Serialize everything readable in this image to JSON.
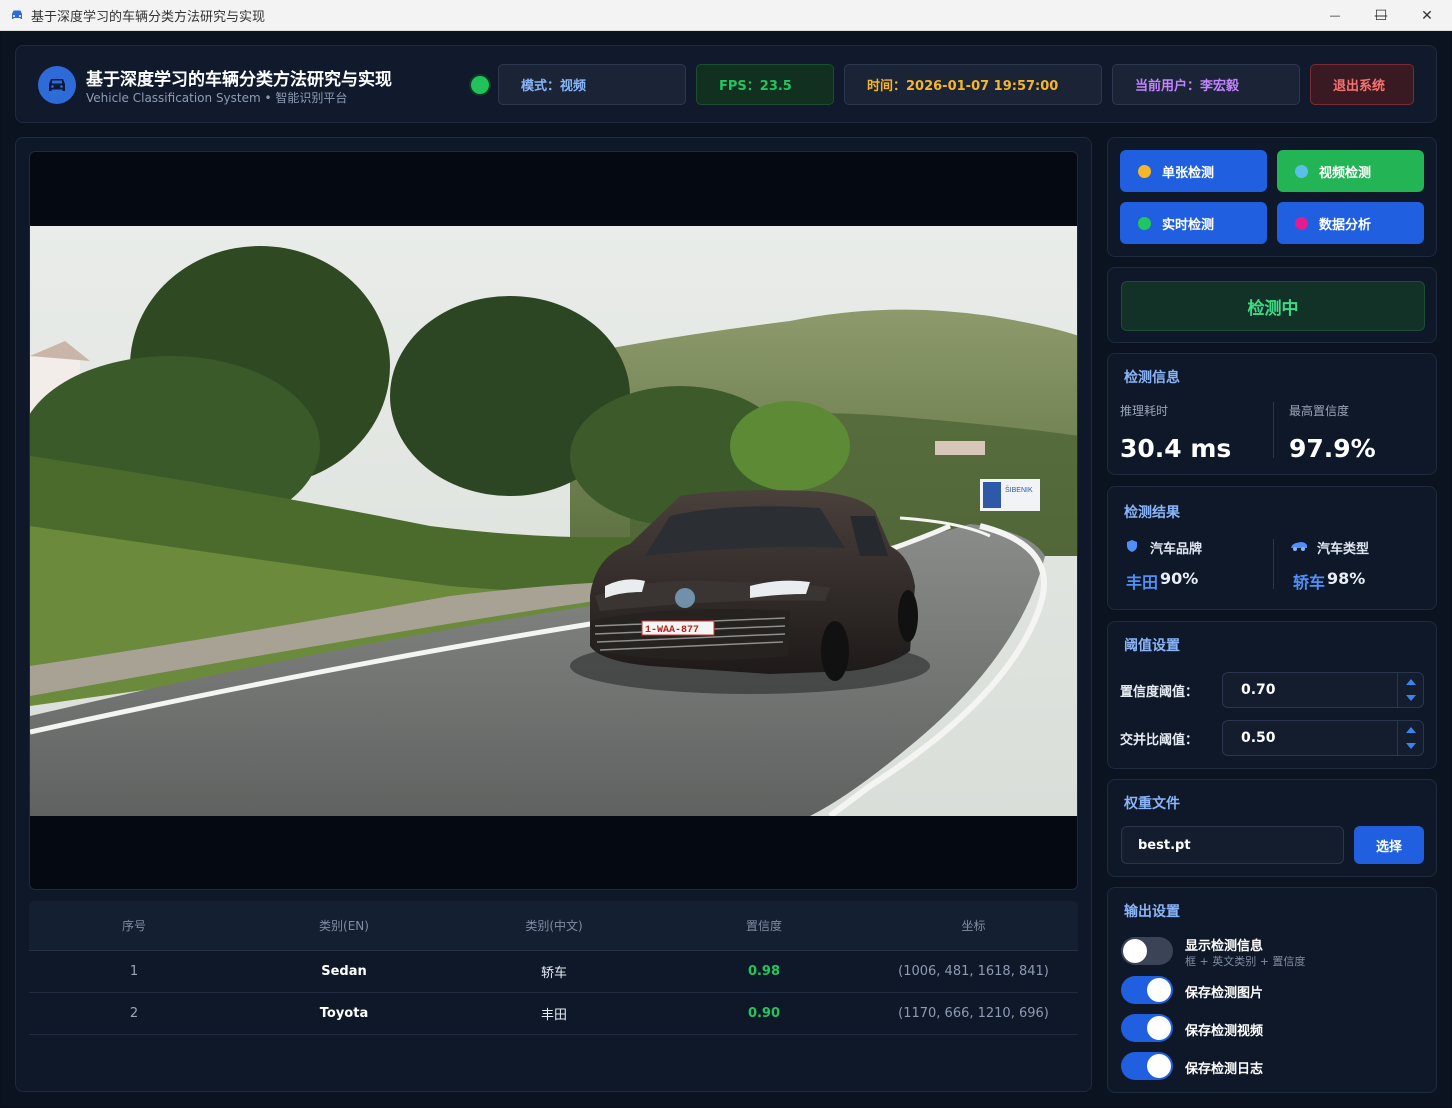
{
  "window": {
    "title": "基于深度学习的车辆分类方法研究与实现",
    "minimize_glyph": "—",
    "maximize_glyph": "☐",
    "close_glyph": "✕"
  },
  "header": {
    "title": "基于深度学习的车辆分类方法研究与实现",
    "subtitle": "Vehicle Classification System • 智能识别平台",
    "status_color": "#1fc25b",
    "mode": "模式：视频",
    "fps": "FPS：23.5",
    "time": "时间：2026-01-07 19:57:00",
    "user": "当前用户：李宏毅",
    "exit": "退出系统"
  },
  "modes": [
    {
      "label": "单张检测",
      "dot_color": "#f5b62a",
      "active": false
    },
    {
      "label": "视频检测",
      "dot_color": "#5bc0e8",
      "active": true
    },
    {
      "label": "实时检测",
      "dot_color": "#22c55e",
      "active": false
    },
    {
      "label": "数据分析",
      "dot_color": "#e11d8f",
      "active": false
    }
  ],
  "detecting_label": "检测中",
  "info": {
    "title": "检测信息",
    "infer_label": "推理耗时",
    "infer_value": "30.4 ms",
    "conf_label": "最高置信度",
    "conf_value": "97.9%"
  },
  "result": {
    "title": "检测结果",
    "brand_label": "汽车品牌",
    "brand_name": "丰田",
    "brand_pct": "90%",
    "type_label": "汽车类型",
    "type_name": "轿车",
    "type_pct": "98%"
  },
  "thresholds": {
    "title": "阈值设置",
    "conf_label": "置信度阈值：",
    "conf_value": "0.70",
    "iou_label": "交并比阈值：",
    "iou_value": "0.50"
  },
  "weights": {
    "title": "权重文件",
    "file": "best.pt",
    "select": "选择"
  },
  "output": {
    "title": "输出设置",
    "toggles": [
      {
        "label": "显示检测信息",
        "sub": "框 + 英文类别 + 置信度",
        "on": false
      },
      {
        "label": "保存检测图片",
        "sub": "",
        "on": true
      },
      {
        "label": "保存检测视频",
        "sub": "",
        "on": true
      },
      {
        "label": "保存检测日志",
        "sub": "",
        "on": true
      }
    ]
  },
  "video": {
    "plate": "1-WAA-877",
    "sign": "ŠIBENIK"
  },
  "table": {
    "headers": [
      "序号",
      "类别(EN)",
      "类别(中文)",
      "置信度",
      "坐标"
    ],
    "rows": [
      {
        "idx": "1",
        "en": "Sedan",
        "cn": "轿车",
        "conf": "0.98",
        "coords": "(1006, 481, 1618, 841)"
      },
      {
        "idx": "2",
        "en": "Toyota",
        "cn": "丰田",
        "conf": "0.90",
        "coords": "(1170, 666, 1210, 696)"
      }
    ]
  },
  "colors": {
    "accent_blue": "#1f5fe0",
    "active_green": "#22b455",
    "confidence_green": "#22c55e",
    "background": "#0b1220"
  }
}
